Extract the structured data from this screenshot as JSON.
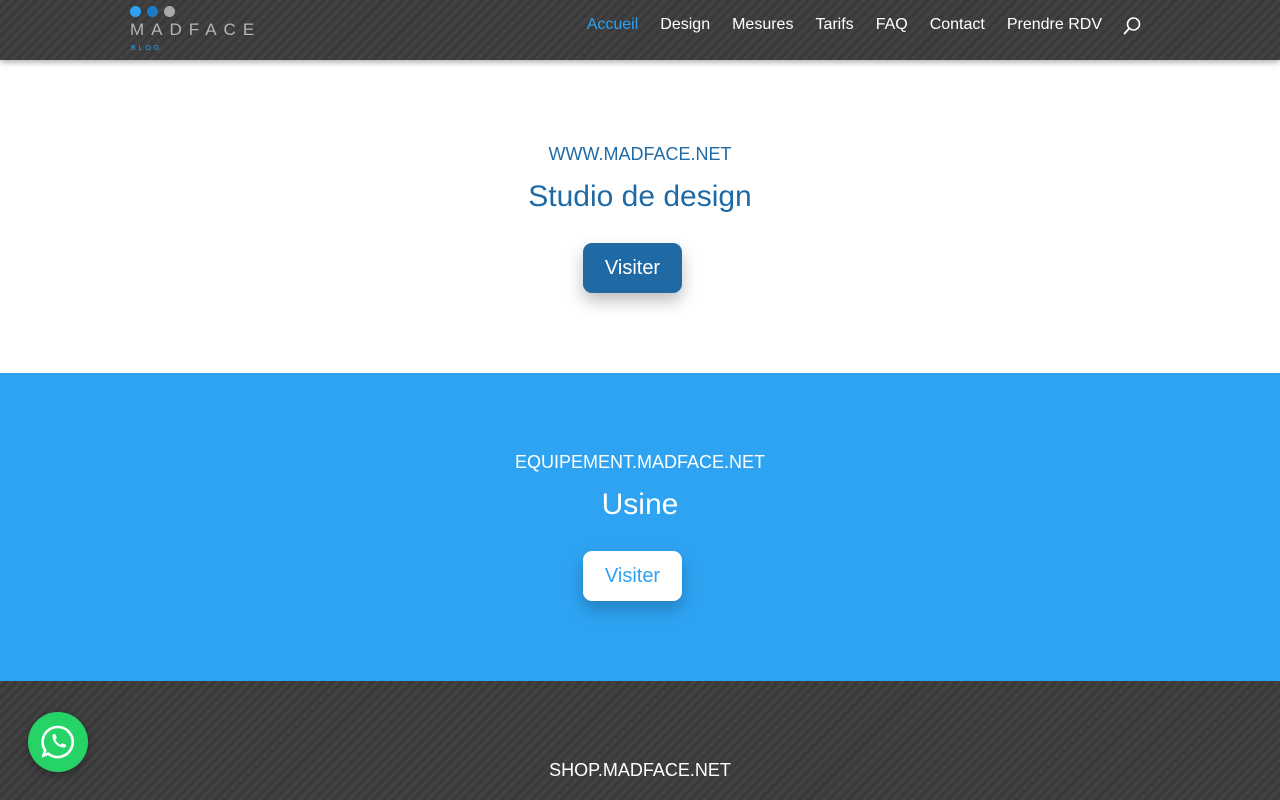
{
  "header": {
    "logo": {
      "word": "MADFACE",
      "sub": "BLOG"
    },
    "nav": [
      {
        "label": "Accueil",
        "active": true
      },
      {
        "label": "Design"
      },
      {
        "label": "Mesures"
      },
      {
        "label": "Tarifs"
      },
      {
        "label": "FAQ"
      },
      {
        "label": "Contact"
      },
      {
        "label": "Prendre RDV"
      }
    ],
    "search_icon": "search-icon"
  },
  "sections": [
    {
      "kicker": "WWW.MADFACE.NET",
      "title": "Studio de design",
      "button": "Visiter"
    },
    {
      "kicker": "EQUIPEMENT.MADFACE.NET",
      "title": "Usine",
      "button": "Visiter"
    },
    {
      "kicker": "SHOP.MADFACE.NET"
    }
  ],
  "floating": {
    "whatsapp_icon": "whatsapp-icon"
  },
  "colors": {
    "accent": "#2ea3f2",
    "dark_blue": "#1f6aa5",
    "whatsapp_green": "#25d366",
    "header_bg": "#3a3a3a"
  }
}
